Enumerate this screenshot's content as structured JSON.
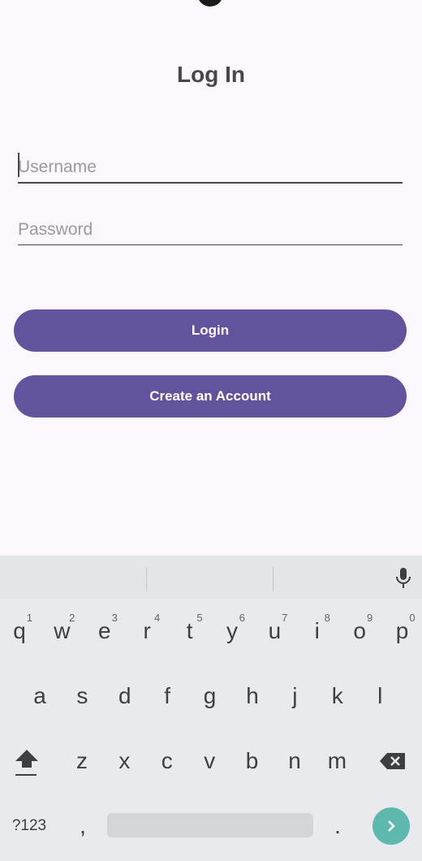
{
  "screen": {
    "title": "Log In"
  },
  "form": {
    "username_placeholder": "Username",
    "password_placeholder": "Password",
    "login_label": "Login",
    "create_account_label": "Create an Account"
  },
  "colors": {
    "background": "#fcf7fc",
    "button": "#62539c",
    "enter_key": "#5fb8ae"
  },
  "keyboard": {
    "row1": [
      {
        "key": "q",
        "hint": "1"
      },
      {
        "key": "w",
        "hint": "2"
      },
      {
        "key": "e",
        "hint": "3"
      },
      {
        "key": "r",
        "hint": "4"
      },
      {
        "key": "t",
        "hint": "5"
      },
      {
        "key": "y",
        "hint": "6"
      },
      {
        "key": "u",
        "hint": "7"
      },
      {
        "key": "i",
        "hint": "8"
      },
      {
        "key": "o",
        "hint": "9"
      },
      {
        "key": "p",
        "hint": "0"
      }
    ],
    "row2": [
      "a",
      "s",
      "d",
      "f",
      "g",
      "h",
      "j",
      "k",
      "l"
    ],
    "row3": [
      "z",
      "x",
      "c",
      "v",
      "b",
      "n",
      "m"
    ],
    "symbols_label": "?123",
    "comma": ",",
    "period": ".",
    "icons": {
      "shift": "shift-icon",
      "backspace": "backspace-icon",
      "mic": "microphone-icon",
      "enter": "enter-arrow-icon"
    }
  }
}
